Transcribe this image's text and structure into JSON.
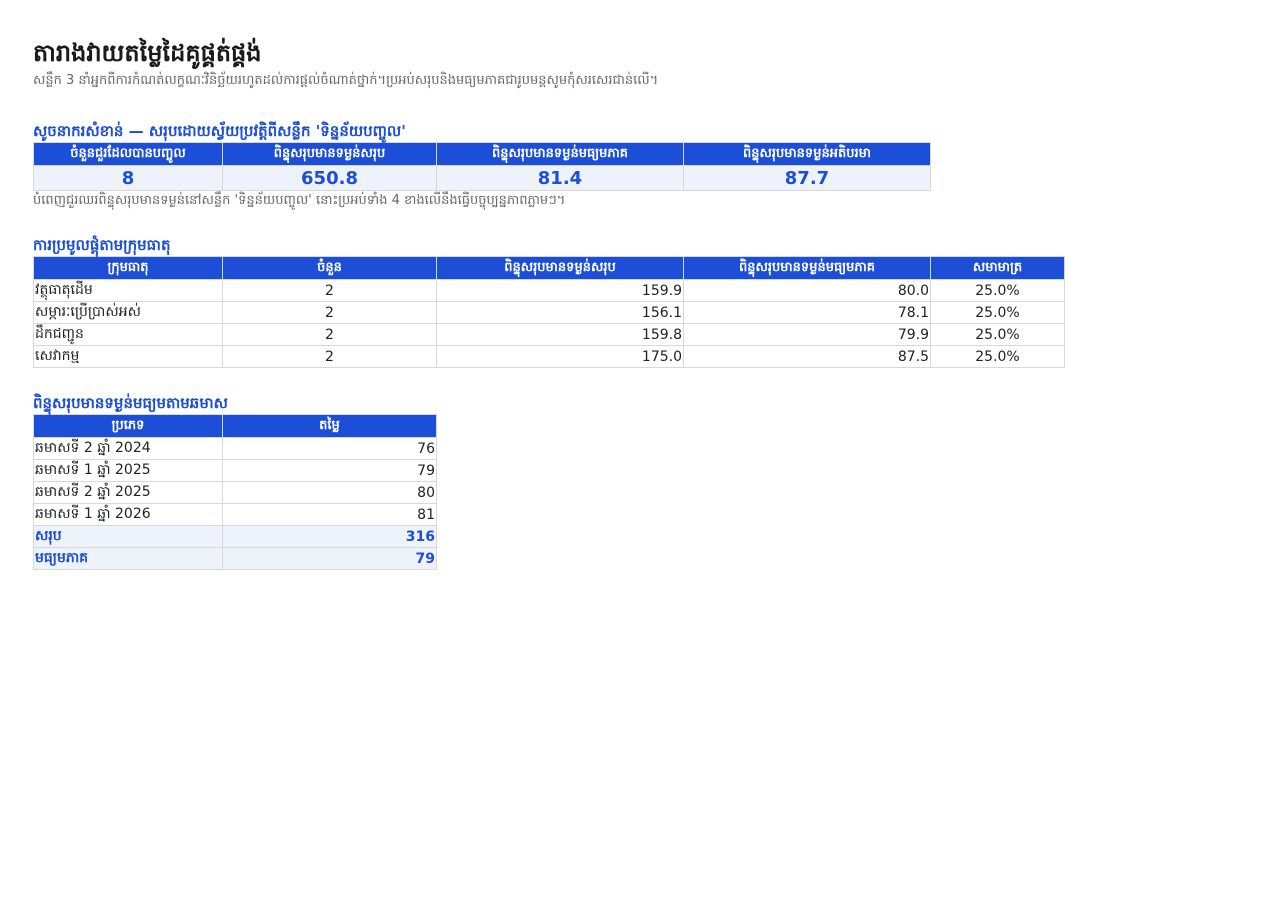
{
  "header": {
    "title": "តារាងវាយតម្លៃដៃគូផ្គត់ផ្គង់",
    "subtitle": "សន្លឹក 3 នាំអ្នកពីការកំណត់លក្ខណៈវិនិច្ឆ័យរហូតដល់ការផ្តល់ចំណាត់ថ្នាក់។ប្រអប់សរុបនិងមធ្យមភាគជារូបមន្តសូមកុំសរសេរជាន់លើ។"
  },
  "kpi": {
    "title": "សូចនាករសំខាន់ — សរុបដោយស្វ័យប្រវត្តិពីសន្លឹក 'ទិន្នន័យបញ្ចូល'",
    "headers": [
      "ចំនួនជួរដែលបានបញ្ចូល",
      "ពិន្ទុសរុបមានទម្ងន់សរុប",
      "ពិន្ទុសរុបមានទម្ងន់មធ្យមភាគ",
      "ពិន្ទុសរុបមានទម្ងន់អតិបរមា"
    ],
    "values": [
      "8",
      "650.8",
      "81.4",
      "87.7"
    ],
    "note": "បំពេញជួរឈរពិន្ទុសរុបមានទម្ងន់នៅសន្លឹក 'ទិន្នន័យបញ្ចូល' នោះប្រអប់ទាំង 4 ខាងលើនឹងធ្វើបច្ចុប្បន្នភាពភ្លាមៗ។"
  },
  "category": {
    "title": "ការប្រមូលផ្តុំតាមក្រុមធាតុ",
    "headers": [
      "ក្រុមធាតុ",
      "ចំនួន",
      "ពិន្ទុសរុបមានទម្ងន់សរុប",
      "ពិន្ទុសរុបមានទម្ងន់មធ្យមភាគ",
      "សមាមាត្រ"
    ],
    "rows": [
      [
        "វត្ថុធាតុដើម",
        "2",
        "159.9",
        "80.0",
        "25.0%"
      ],
      [
        "សម្ភារៈប្រើប្រាស់អស់",
        "2",
        "156.1",
        "78.1",
        "25.0%"
      ],
      [
        "ដឹកជញ្ជូន",
        "2",
        "159.8",
        "79.9",
        "25.0%"
      ],
      [
        "សេវាកម្ម",
        "2",
        "175.0",
        "87.5",
        "25.0%"
      ]
    ]
  },
  "quarter": {
    "title": "ពិន្ទុសរុបមានទម្ងន់មធ្យមតាមឆមាស",
    "headers": [
      "ប្រភេទ",
      "តម្លៃ"
    ],
    "rows": [
      [
        "ឆមាសទី 2 ឆ្នាំ 2024",
        "76"
      ],
      [
        "ឆមាសទី 1 ឆ្នាំ 2025",
        "79"
      ],
      [
        "ឆមាសទី 2 ឆ្នាំ 2025",
        "80"
      ],
      [
        "ឆមាសទី 1 ឆ្នាំ 2026",
        "81"
      ]
    ],
    "total_label": "សរុប",
    "total_value": "316",
    "avg_label": "មធ្យមភាគ",
    "avg_value": "79"
  },
  "colors": {
    "accent": "#1d4ed8",
    "summary_bg": "#eef2fb"
  }
}
